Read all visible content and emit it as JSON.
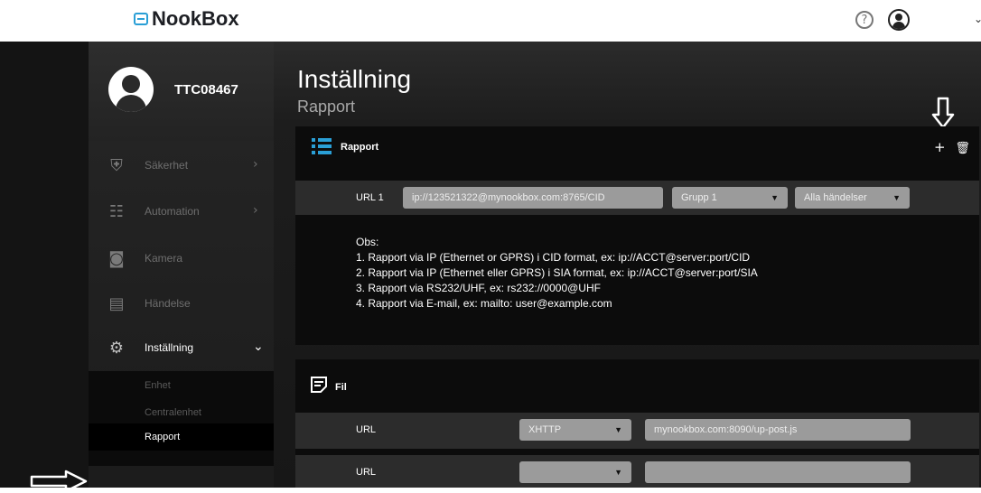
{
  "topbar": {
    "brand": "NookBox",
    "help_glyph": "?"
  },
  "profile": {
    "name": "TTC08467"
  },
  "nav": {
    "items": [
      {
        "label": "Säkerhet",
        "icon": "shield-icon",
        "chevron": "›"
      },
      {
        "label": "Automation",
        "icon": "sliders-icon",
        "chevron": "›"
      },
      {
        "label": "Kamera",
        "icon": "camera-icon"
      },
      {
        "label": "Händelse",
        "icon": "event-log-icon"
      },
      {
        "label": "Inställning",
        "icon": "gear-icon",
        "chevron": "⌄"
      }
    ],
    "sub": [
      "Enhet",
      "Centralenhet",
      "Rapport"
    ]
  },
  "page": {
    "title": "Inställning",
    "subtitle": "Rapport"
  },
  "rapport": {
    "title": "Rapport",
    "row": {
      "label": "URL 1",
      "url": "ip://123521322@mynookbox.com:8765/CID",
      "group": "Grupp 1",
      "events": "Alla händelser"
    },
    "notes": [
      "Obs:",
      "1. Rapport via IP (Ethernet or GPRS) i CID format, ex: ip://ACCT@server:port/CID",
      "2. Rapport via IP (Ethernet eller GPRS) i SIA format, ex: ip://ACCT@server:port/SIA",
      "3. Rapport via RS232/UHF, ex: rs232://0000@UHF",
      "4. Rapport via E-mail, ex: mailto: user@example.com"
    ]
  },
  "fil": {
    "title": "Fil",
    "rows": [
      {
        "label": "URL",
        "method": "XHTTP",
        "value": "mynookbox.com:8090/up-post.js"
      },
      {
        "label": "URL",
        "method": "",
        "value": ""
      }
    ]
  },
  "colors": {
    "accent": "#2a9fd6",
    "field": "#9b9b9b",
    "panel": "#0c0c0c"
  }
}
